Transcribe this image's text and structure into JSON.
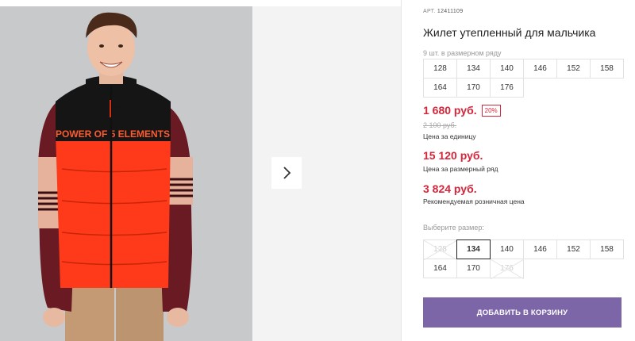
{
  "product": {
    "sku_label": "АРТ.",
    "sku": "12411109",
    "title": "Жилет утепленный для мальчика",
    "size_run_note": "9 шт. в размерном ряду",
    "size_run": [
      "128",
      "134",
      "140",
      "146",
      "152",
      "158",
      "164",
      "170",
      "176"
    ],
    "price": "1 680 руб.",
    "discount": "20%",
    "old_price": "2 100 руб.",
    "price_unit_label": "Цена за единицу",
    "run_price": "15 120 руб.",
    "run_price_label": "Цена за размерный ряд",
    "retail_price": "3 824 руб.",
    "retail_price_label": "Рекомендуемая розничная цена"
  },
  "size_select": {
    "label": "Выберите размер:",
    "selected": "134",
    "options": [
      {
        "value": "128",
        "available": false
      },
      {
        "value": "134",
        "available": true
      },
      {
        "value": "140",
        "available": true
      },
      {
        "value": "146",
        "available": true
      },
      {
        "value": "152",
        "available": true
      },
      {
        "value": "158",
        "available": true
      },
      {
        "value": "164",
        "available": true
      },
      {
        "value": "170",
        "available": true
      },
      {
        "value": "176",
        "available": false
      }
    ]
  },
  "gallery": {
    "next_icon": "chevron-right-icon",
    "print_text": "POWER OF 5 ELEMENTS"
  },
  "cart": {
    "add_label": "ДОБАВИТЬ В КОРЗИНУ"
  },
  "colors": {
    "price_red": "#d5263b",
    "button_purple": "#7c66a8",
    "vest_orange": "#ff3a1a"
  }
}
